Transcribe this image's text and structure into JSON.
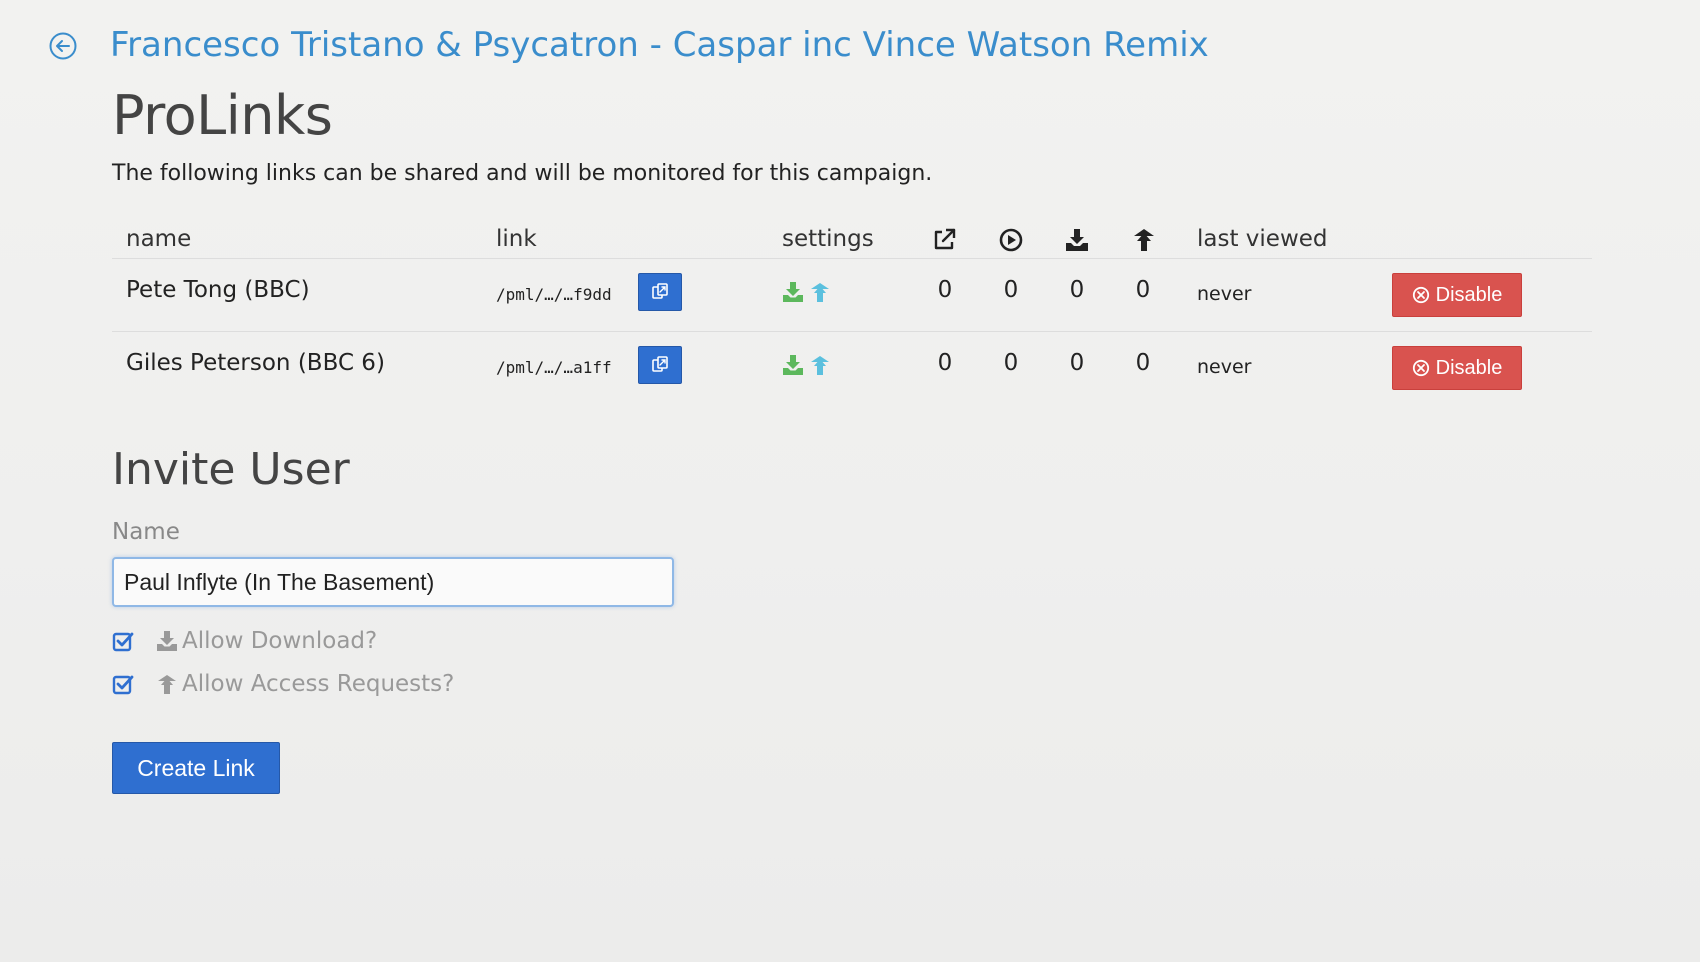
{
  "header": {
    "campaign_title": "Francesco Tristano & Psycatron - Caspar inc Vince Watson Remix",
    "page_title": "ProLinks",
    "description": "The following links can be shared and will be monitored for this campaign."
  },
  "table": {
    "columns": {
      "name": "name",
      "link": "link",
      "settings": "settings",
      "last_viewed": "last viewed"
    },
    "column_icons": [
      "external-link-icon",
      "play-circle-icon",
      "download-icon",
      "access-request-icon"
    ],
    "rows": [
      {
        "name": "Pete Tong (BBC)",
        "link": "/pml/…/…f9dd",
        "opens": "0",
        "plays": "0",
        "downloads": "0",
        "requests": "0",
        "last_viewed": "never",
        "disable_label": "Disable"
      },
      {
        "name": "Giles Peterson (BBC 6)",
        "link": "/pml/…/…a1ff",
        "opens": "0",
        "plays": "0",
        "downloads": "0",
        "requests": "0",
        "last_viewed": "never",
        "disable_label": "Disable"
      }
    ]
  },
  "invite": {
    "title": "Invite User",
    "name_label": "Name",
    "name_value": "Paul Inflyte (In The Basement)",
    "allow_download_label": "Allow Download?",
    "allow_download_checked": true,
    "allow_requests_label": "Allow Access Requests?",
    "allow_requests_checked": true,
    "create_label": "Create Link"
  },
  "colors": {
    "link_blue": "#3a8dcc",
    "primary_button": "#2f6fd0",
    "danger_button": "#d9534f",
    "download_green": "#5cb85c",
    "request_blue": "#5bc0de"
  }
}
